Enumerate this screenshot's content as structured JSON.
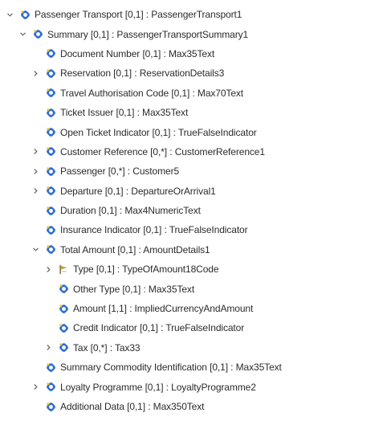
{
  "colors": {
    "class_icon": "#2f6fd1",
    "class_icon_accent": "#f1c232",
    "code_icon": "#c9a227",
    "text": "#2b2b2b",
    "twisty": "#6a6a6a"
  },
  "tree": [
    {
      "label": "Passenger Transport [0,1] : PassengerTransport1",
      "depth": 0,
      "twisty": "expanded",
      "icon": "class-icon"
    },
    {
      "label": "Summary [0,1] : PassengerTransportSummary1",
      "depth": 1,
      "twisty": "expanded",
      "icon": "class-icon"
    },
    {
      "label": "Document Number [0,1] : Max35Text",
      "depth": 2,
      "twisty": "none",
      "icon": "class-icon"
    },
    {
      "label": "Reservation [0,1] : ReservationDetails3",
      "depth": 2,
      "twisty": "collapsed",
      "icon": "class-icon"
    },
    {
      "label": "Travel Authorisation Code [0,1] : Max70Text",
      "depth": 2,
      "twisty": "none",
      "icon": "class-icon"
    },
    {
      "label": "Ticket Issuer [0,1] : Max35Text",
      "depth": 2,
      "twisty": "none",
      "icon": "class-icon"
    },
    {
      "label": "Open Ticket Indicator [0,1] : TrueFalseIndicator",
      "depth": 2,
      "twisty": "none",
      "icon": "class-icon"
    },
    {
      "label": "Customer Reference [0,*] : CustomerReference1",
      "depth": 2,
      "twisty": "collapsed",
      "icon": "class-icon"
    },
    {
      "label": "Passenger [0,*] : Customer5",
      "depth": 2,
      "twisty": "collapsed",
      "icon": "class-icon"
    },
    {
      "label": "Departure [0,1] : DepartureOrArrival1",
      "depth": 2,
      "twisty": "collapsed",
      "icon": "class-icon"
    },
    {
      "label": "Duration [0,1] : Max4NumericText",
      "depth": 2,
      "twisty": "none",
      "icon": "class-icon"
    },
    {
      "label": "Insurance Indicator [0,1] : TrueFalseIndicator",
      "depth": 2,
      "twisty": "none",
      "icon": "class-icon"
    },
    {
      "label": "Total Amount [0,1] : AmountDetails1",
      "depth": 2,
      "twisty": "expanded",
      "icon": "class-icon"
    },
    {
      "label": "Type [0,1] : TypeOfAmount18Code",
      "depth": 3,
      "twisty": "collapsed",
      "icon": "code-icon"
    },
    {
      "label": "Other Type [0,1] : Max35Text",
      "depth": 3,
      "twisty": "none",
      "icon": "class-icon"
    },
    {
      "label": "Amount [1,1] : ImpliedCurrencyAndAmount",
      "depth": 3,
      "twisty": "none",
      "icon": "class-icon"
    },
    {
      "label": "Credit Indicator [0,1] : TrueFalseIndicator",
      "depth": 3,
      "twisty": "none",
      "icon": "class-icon"
    },
    {
      "label": "Tax [0,*] : Tax33",
      "depth": 3,
      "twisty": "collapsed",
      "icon": "class-icon"
    },
    {
      "label": "Summary Commodity Identification [0,1] : Max35Text",
      "depth": 2,
      "twisty": "none",
      "icon": "class-icon"
    },
    {
      "label": "Loyalty Programme [0,1] : LoyaltyProgramme2",
      "depth": 2,
      "twisty": "collapsed",
      "icon": "class-icon"
    },
    {
      "label": "Additional Data [0,1] : Max350Text",
      "depth": 2,
      "twisty": "none",
      "icon": "class-icon"
    }
  ]
}
